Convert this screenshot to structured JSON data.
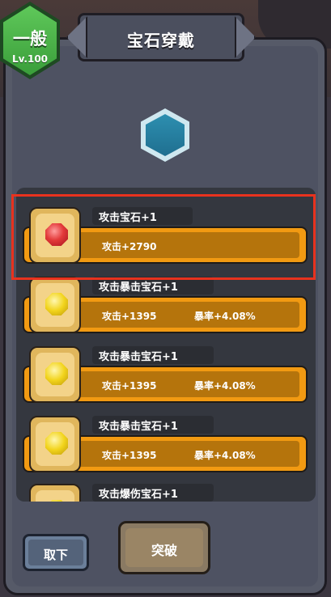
{
  "header": {
    "title": "宝石穿戴"
  },
  "badge": {
    "grade": "一般",
    "level": "Lv.100"
  },
  "gems": [
    {
      "name": "攻击宝石+1",
      "stat1": "攻击+2790",
      "stat2": "",
      "color": "red"
    },
    {
      "name": "攻击暴击宝石+1",
      "stat1": "攻击+1395",
      "stat2": "暴率+4.08%",
      "color": "yellow"
    },
    {
      "name": "攻击暴击宝石+1",
      "stat1": "攻击+1395",
      "stat2": "暴率+4.08%",
      "color": "yellow"
    },
    {
      "name": "攻击暴击宝石+1",
      "stat1": "攻击+1395",
      "stat2": "暴率+4.08%",
      "color": "yellow"
    },
    {
      "name": "攻击爆伤宝石+1",
      "stat1": "",
      "stat2": "",
      "color": "yellow"
    }
  ],
  "buttons": {
    "take_off": "取下",
    "breakthrough": "突破"
  },
  "colors": {
    "accent_orange": "#f29a12",
    "highlight_red": "#e8321e",
    "grade_green": "#4cb84a"
  }
}
